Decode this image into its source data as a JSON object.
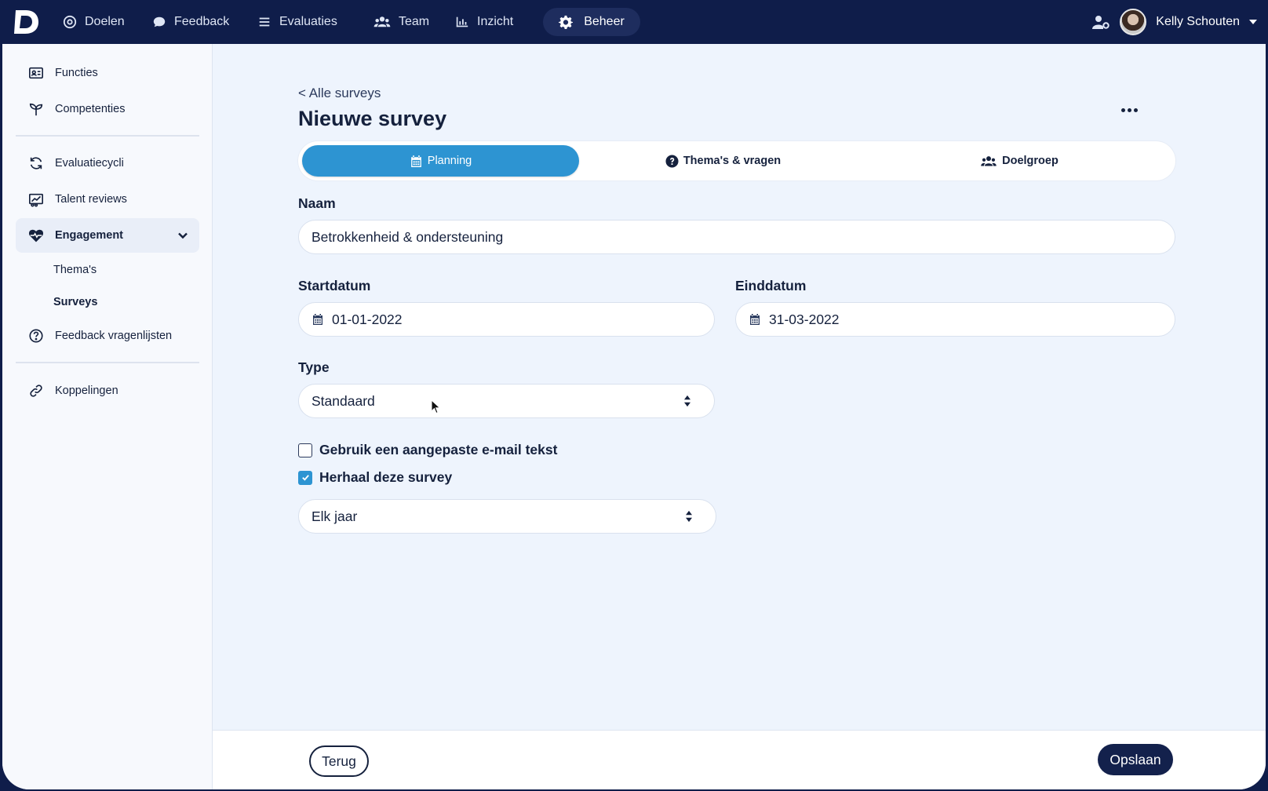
{
  "nav": {
    "items": [
      {
        "label": "Doelen",
        "icon": "target-icon"
      },
      {
        "label": "Feedback",
        "icon": "chat-bubble-icon"
      },
      {
        "label": "Evaluaties",
        "icon": "list-icon"
      },
      {
        "label": "Team",
        "icon": "users-icon"
      },
      {
        "label": "Inzicht",
        "icon": "bar-chart-icon"
      },
      {
        "label": "Beheer",
        "icon": "gear-icon"
      }
    ],
    "active": "Beheer",
    "user_name": "Kelly Schouten"
  },
  "sidebar": {
    "items": [
      {
        "label": "Functies",
        "icon": "id-card-icon"
      },
      {
        "label": "Competenties",
        "icon": "seedling-icon"
      },
      {
        "label": "Evaluatiecycli",
        "icon": "sync-icon"
      },
      {
        "label": "Talent reviews",
        "icon": "chart-board-icon"
      },
      {
        "label": "Engagement",
        "icon": "heart-pulse-icon"
      },
      {
        "label": "Feedback vragenlijsten",
        "icon": "question-circle-icon"
      },
      {
        "label": "Koppelingen",
        "icon": "link-icon"
      }
    ],
    "subitems": [
      {
        "label": "Thema's"
      },
      {
        "label": "Surveys"
      }
    ]
  },
  "page": {
    "back_link": "< Alle surveys",
    "title": "Nieuwe survey"
  },
  "tabs": [
    {
      "label": "Planning",
      "icon": "calendar-icon",
      "active": true
    },
    {
      "label": "Thema's & vragen",
      "icon": "question-circle-icon",
      "active": false
    },
    {
      "label": "Doelgroep",
      "icon": "users-icon",
      "active": false
    }
  ],
  "form": {
    "name_label": "Naam",
    "name_value": "Betrokkenheid & ondersteuning",
    "start_label": "Startdatum",
    "start_value": "01-01-2022",
    "end_label": "Einddatum",
    "end_value": "31-03-2022",
    "type_label": "Type",
    "type_value": "Standaard",
    "custom_email_label": "Gebruik een aangepaste e-mail tekst",
    "custom_email_checked": false,
    "repeat_label": "Herhaal deze survey",
    "repeat_checked": true,
    "repeat_value": "Elk jaar"
  },
  "footer": {
    "back_label": "Terug",
    "save_label": "Opslaan"
  },
  "colors": {
    "nav_bg": "#0f1d4a",
    "accent": "#2d94d2",
    "primary_button": "#13214c",
    "content_bg": "#eef4fd"
  }
}
